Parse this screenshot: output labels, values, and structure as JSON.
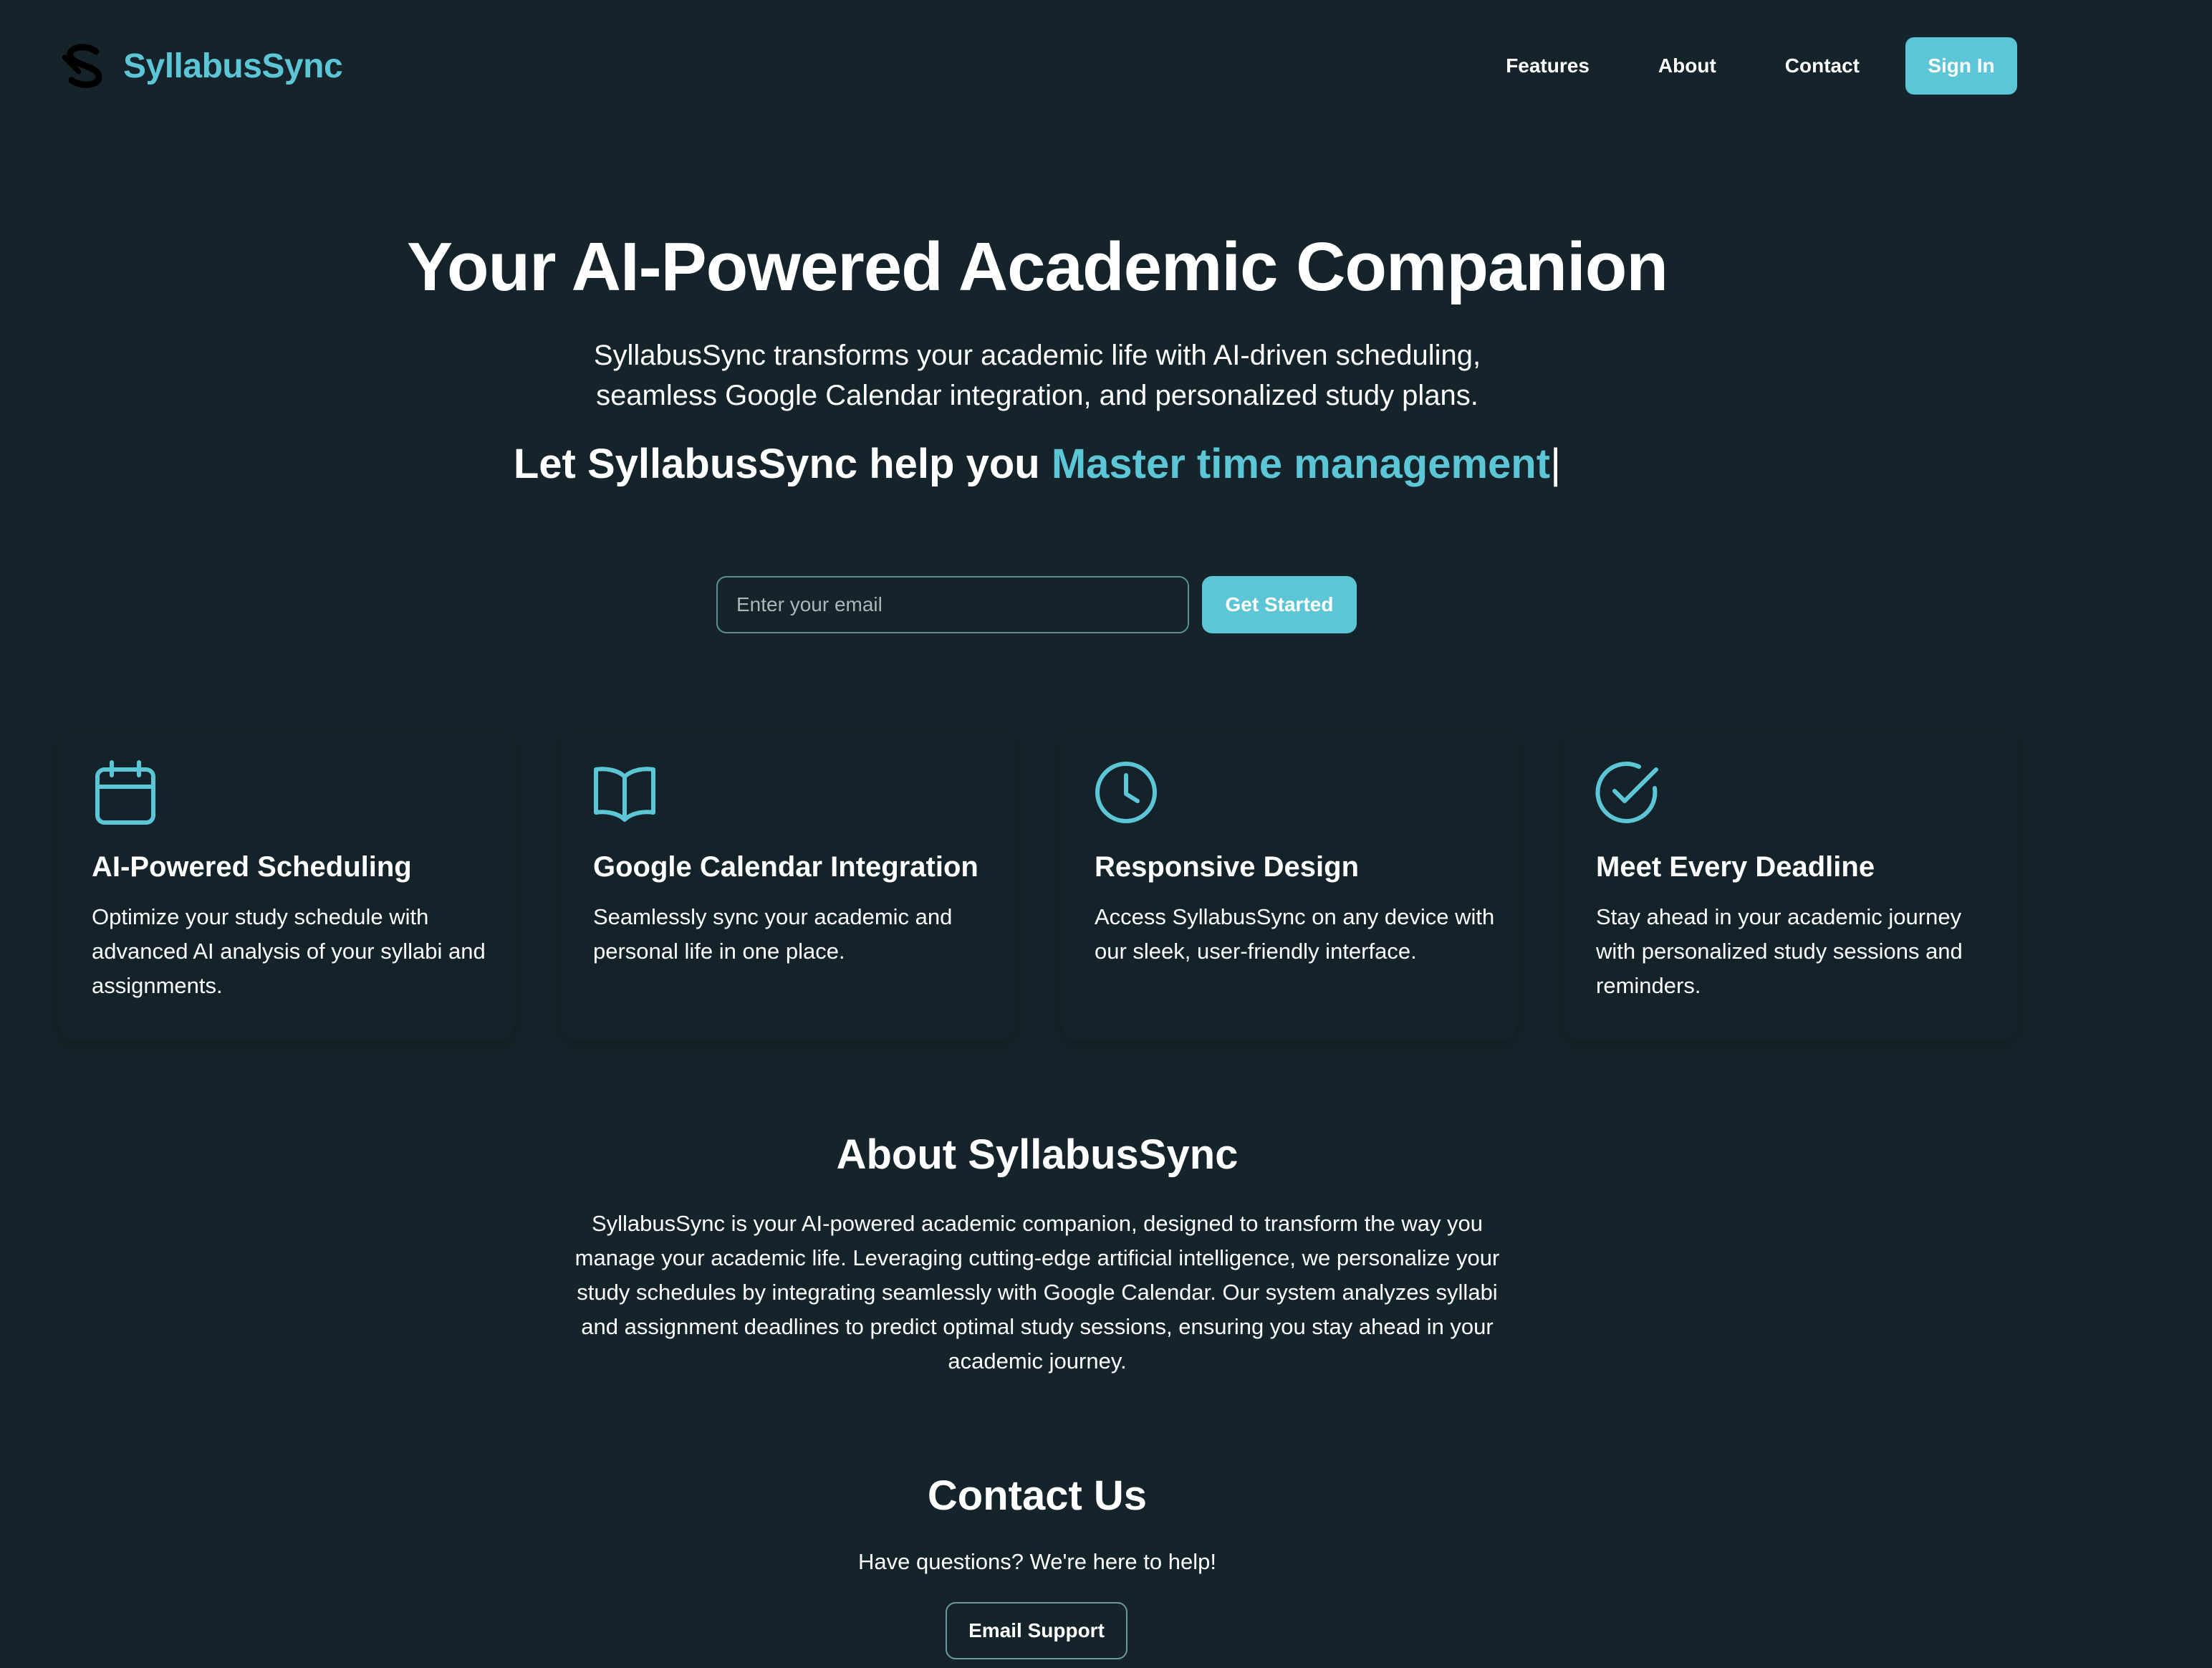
{
  "nav": {
    "brand": "SyllabusSync",
    "links": [
      "Features",
      "About",
      "Contact"
    ],
    "signin": "Sign In"
  },
  "hero": {
    "title": "Your AI-Powered Academic Companion",
    "subtitle_line1": "SyllabusSync transforms your academic life with AI-driven scheduling,",
    "subtitle_line2": "seamless Google Calendar integration, and personalized study plans.",
    "tagline_prefix": "Let SyllabusSync help you ",
    "tagline_accent": "Master time management",
    "tagline_cursor": "|",
    "email_placeholder": "Enter your email",
    "email_value": "",
    "cta": "Get Started"
  },
  "features": [
    {
      "icon": "calendar-icon",
      "title": "AI-Powered Scheduling",
      "description": "Optimize your study schedule with advanced AI analysis of your syllabi and assignments."
    },
    {
      "icon": "book-open-icon",
      "title": "Google Calendar Integration",
      "description": "Seamlessly sync your academic and personal life in one place."
    },
    {
      "icon": "clock-icon",
      "title": "Responsive Design",
      "description": "Access SyllabusSync on any device with our sleek, user-friendly interface."
    },
    {
      "icon": "check-circle-icon",
      "title": "Meet Every Deadline",
      "description": "Stay ahead in your academic journey with personalized study sessions and reminders."
    }
  ],
  "about": {
    "title": "About SyllabusSync",
    "text": "SyllabusSync is your AI-powered academic companion, designed to transform the way you manage your academic life. Leveraging cutting-edge artificial intelligence, we personalize your study schedules by integrating seamlessly with Google Calendar. Our system analyzes syllabi and assignment deadlines to predict optimal study sessions, ensuring you stay ahead in your academic journey."
  },
  "contact": {
    "title": "Contact Us",
    "subtitle": "Have questions? We're here to help!",
    "button": "Email Support"
  },
  "colors": {
    "background": "#15232a",
    "accent": "#5cc6d6",
    "text": "#ffffff"
  }
}
